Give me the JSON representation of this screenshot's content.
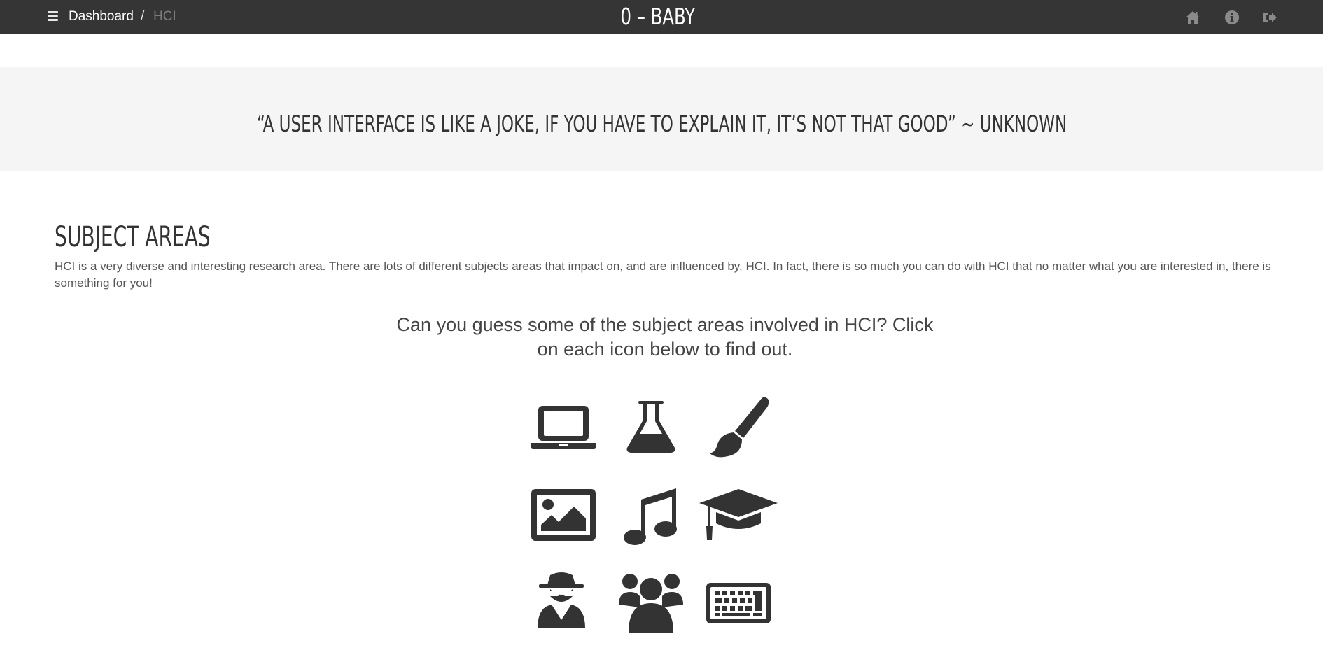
{
  "topbar": {
    "breadcrumb_home": "Dashboard",
    "breadcrumb_separator": "/",
    "breadcrumb_current": "HCI",
    "app_title": "0 – BABY",
    "icons": [
      "home-icon",
      "info-icon",
      "logout-icon"
    ]
  },
  "quote": {
    "text": "“A USER INTERFACE IS LIKE A JOKE, IF YOU HAVE TO EXPLAIN IT, IT’S NOT THAT GOOD” ~ UNKNOWN"
  },
  "subject_areas": {
    "title": "SUBJECT AREAS",
    "description": "HCI is a very diverse and interesting research area. There are lots of different subjects areas that impact on, and are influenced by, HCI. In fact, there is so much you can do with HCI that no matter what you are interested in, there is something for you!",
    "prompt": "Can you guess some of the subject areas involved in HCI? Click on each icon below to find out.",
    "icons": [
      "laptop-icon",
      "flask-icon",
      "paintbrush-icon",
      "image-icon",
      "music-icon",
      "graduation-cap-icon",
      "spy-icon",
      "group-icon",
      "keyboard-icon"
    ]
  },
  "colors": {
    "topbar_bg": "#353535",
    "quote_band_bg": "#f5f5f5",
    "icon_color": "#333333"
  }
}
